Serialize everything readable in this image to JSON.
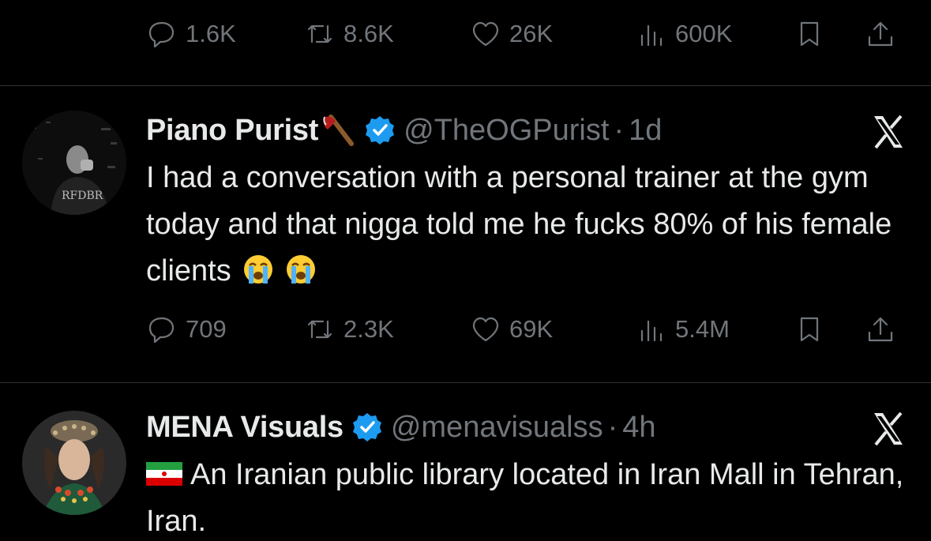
{
  "top_actions": {
    "replies": "1.6K",
    "reposts": "8.6K",
    "likes": "26K",
    "views": "600K"
  },
  "tweets": [
    {
      "display_name": "Piano Purist",
      "name_emoji": "🪓",
      "handle": "@TheOGPurist",
      "separator": "·",
      "time": "1d",
      "text": "I had a conversation with a personal trainer at the gym today and that nigga told me he fucks 80% of his female clients",
      "text_emoji": "😭 😭",
      "actions": {
        "replies": "709",
        "reposts": "2.3K",
        "likes": "69K",
        "views": "5.4M"
      }
    },
    {
      "display_name": "MENA Visuals",
      "handle": "@menavisualss",
      "separator": "·",
      "time": "4h",
      "flag": "🇮🇷",
      "text": "An Iranian public library located in Iran Mall in Tehran, Iran."
    }
  ],
  "colors": {
    "background": "#000000",
    "text": "#e7e9ea",
    "muted": "#71767b",
    "verified": "#1d9bf0",
    "divider": "#2f3336"
  }
}
